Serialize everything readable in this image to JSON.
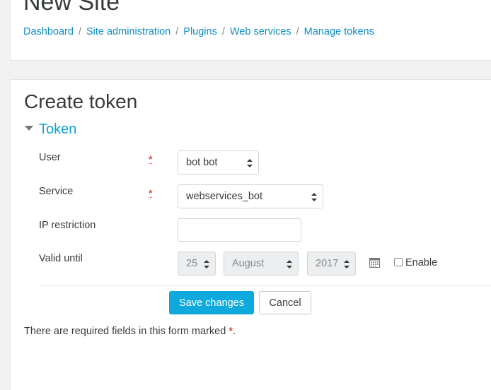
{
  "header": {
    "site_title": "New Site",
    "breadcrumb": [
      "Dashboard",
      "Site administration",
      "Plugins",
      "Web services",
      "Manage tokens"
    ],
    "breadcrumb_separator": "/"
  },
  "main": {
    "heading": "Create token",
    "legend": "Token",
    "required_marker": "*",
    "fields": {
      "user": {
        "label": "User",
        "value": "bot bot"
      },
      "service": {
        "label": "Service",
        "value": "webservices_bot"
      },
      "ip_restriction": {
        "label": "IP restriction",
        "value": ""
      },
      "valid_until": {
        "label": "Valid until",
        "day": "25",
        "month": "August",
        "year": "2017",
        "enable_label": "Enable",
        "enabled": false
      }
    },
    "buttons": {
      "save": "Save changes",
      "cancel": "Cancel"
    },
    "required_note": {
      "text": "There are required fields in this form marked ",
      "star": "*",
      "end": "."
    }
  },
  "colors": {
    "link": "#0f8dc7",
    "accent": "#0faadd",
    "required": "#d9534f"
  },
  "icons": [
    "caret-down-icon",
    "required-icon",
    "calendar-icon",
    "select-arrows-icon"
  ]
}
